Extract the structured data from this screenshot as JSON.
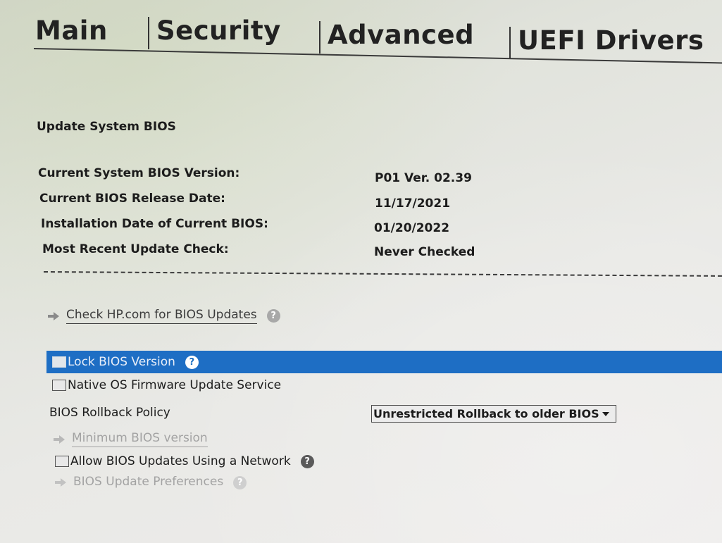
{
  "tabs": [
    {
      "label": "Main"
    },
    {
      "label": "Security"
    },
    {
      "label": "Advanced"
    },
    {
      "label": "UEFI Drivers"
    }
  ],
  "section": {
    "title": "Update System BIOS"
  },
  "info": [
    {
      "label": "Current System BIOS Version:",
      "value": "P01 Ver. 02.39"
    },
    {
      "label": "Current BIOS Release Date:",
      "value": "11/17/2021"
    },
    {
      "label": "Installation Date of Current BIOS:",
      "value": "01/20/2022"
    },
    {
      "label": "Most Recent Update Check:",
      "value": "Never Checked"
    }
  ],
  "check_hp_link": "Check HP.com for BIOS Updates",
  "options": {
    "lock_bios": "Lock BIOS Version",
    "native_os_firmware": "Native OS Firmware Update Service",
    "rollback_policy_label": "BIOS Rollback Policy",
    "rollback_policy_value": "Unrestricted Rollback to older BIOS",
    "minimum_bios_link": "Minimum BIOS version",
    "allow_network": "Allow BIOS Updates Using a Network",
    "update_preferences_link": "BIOS Update Preferences"
  },
  "icons": {
    "arrow": "arrow-right-icon",
    "help": "question-mark-icon",
    "dropdown": "chevron-down-icon"
  },
  "colors": {
    "highlight": "#1e6ec4",
    "text": "#1c1c1c",
    "disabled": "#a3a3a3"
  }
}
